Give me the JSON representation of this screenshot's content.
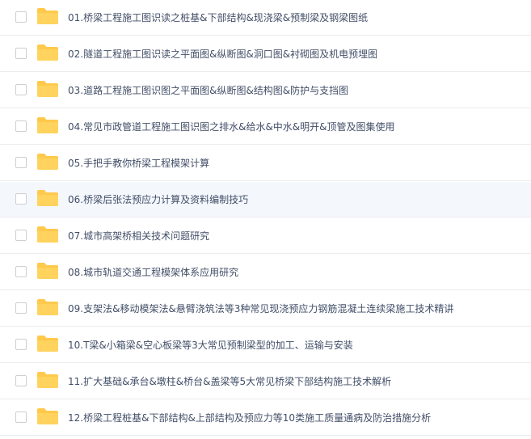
{
  "file_list": {
    "icon": "folder-icon",
    "icon_color": "#ffc94c",
    "hover_color": "#f4f8fd",
    "items": [
      {
        "name": "01.桥梁工程施工图识读之桩基&下部结构&现浇梁&预制梁及钢梁图纸"
      },
      {
        "name": "02.隧道工程施工图识读之平面图&纵断图&洞口图&衬砌图及机电预埋图"
      },
      {
        "name": "03.道路工程施工图识图之平面图&纵断图&结构图&防护与支挡图"
      },
      {
        "name": "04.常见市政管道工程施工图识图之排水&给水&中水&明开&顶管及图集使用"
      },
      {
        "name": "05.手把手教你桥梁工程模架计算"
      },
      {
        "name": "06.桥梁后张法预应力计算及资料编制技巧"
      },
      {
        "name": "07.城市高架桥相关技术问题研究"
      },
      {
        "name": "08.城市轨道交通工程模架体系应用研究"
      },
      {
        "name": "09.支架法&移动模架法&悬臂浇筑法等3种常见现浇预应力钢筋混凝土连续梁施工技术精讲"
      },
      {
        "name": "10.T梁&小箱梁&空心板梁等3大常见预制梁型的加工、运输与安装"
      },
      {
        "name": "11.扩大基础&承台&墩柱&桥台&盖梁等5大常见桥梁下部结构施工技术解析"
      },
      {
        "name": "12.桥梁工程桩基&下部结构&上部结构及预应力等10类施工质量通病及防治措施分析"
      }
    ]
  }
}
